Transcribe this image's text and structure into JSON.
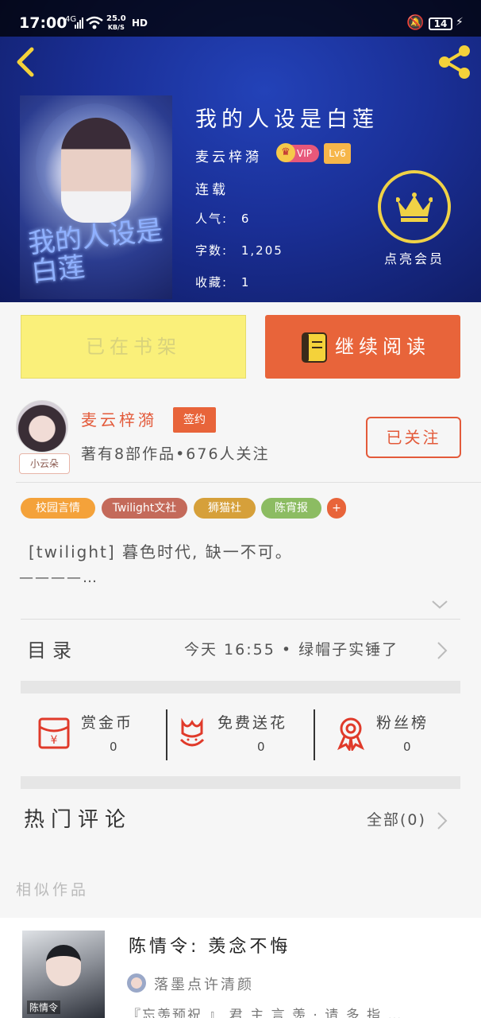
{
  "status_bar": {
    "time": "17:00",
    "network": "4G",
    "speed_value": "25.0",
    "speed_unit": "KB/S",
    "hd": "HD",
    "battery": "14"
  },
  "book": {
    "title": "我的人设是白莲",
    "author": "麦云梓漪",
    "vip": "VIP",
    "level": "Lv6",
    "status": "连载",
    "popularity_label": "人气:",
    "popularity_value": "6",
    "words_label": "字数:",
    "words_value": "1,205",
    "collect_label": "收藏:",
    "collect_value": "1",
    "cover_text": "我的人设是白莲"
  },
  "member": {
    "label": "点亮会员"
  },
  "actions": {
    "shelf": "已在书架",
    "read": "继续阅读"
  },
  "author_card": {
    "name": "麦云梓漪",
    "badge": "签约",
    "avatar_tag": "小云朵",
    "stats": "著有8部作品•676人关注",
    "follow": "已关注"
  },
  "tags": [
    {
      "label": "校园言情",
      "color": "#f4a23a"
    },
    {
      "label": "Twilight文社",
      "color": "#c46a5a"
    },
    {
      "label": "狮猫社",
      "color": "#d6a03a"
    },
    {
      "label": "陈宵报",
      "color": "#8cbc62"
    }
  ],
  "tags_more": "+",
  "description": {
    "line1": "[twilight] 暮色时代, 缺一不可。",
    "line2": "————…"
  },
  "toc": {
    "label": "目录",
    "latest": "今天 16:55 • 绿帽子实锤了"
  },
  "gifts": [
    {
      "label": "赏金币",
      "count": "0",
      "icon": "red-envelope-icon"
    },
    {
      "label": "免费送花",
      "count": "0",
      "icon": "flower-icon"
    },
    {
      "label": "粉丝榜",
      "count": "0",
      "icon": "medal-icon"
    }
  ],
  "comments": {
    "title": "热门评论",
    "all": "全部(0)"
  },
  "similar": {
    "title": "相似作品",
    "item": {
      "title": "陈情令: 羡念不悔",
      "author": "落墨点许清颜",
      "desc": "『忘羡预祝 』 君 主 言 羡 · 请 多 指 …",
      "cover_label": "陈情令"
    }
  },
  "colors": {
    "accent": "#e8643a",
    "header": "#1a2f96",
    "gold": "#f0d246",
    "shelf": "#faf07a"
  }
}
